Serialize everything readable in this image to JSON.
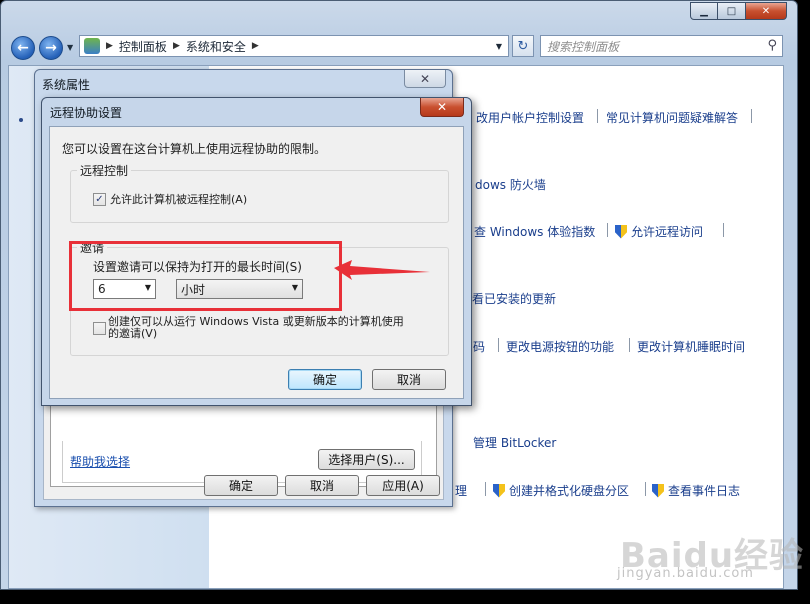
{
  "explorer": {
    "back_glyph": "←",
    "forward_glyph": "→",
    "breadcrumb": [
      "控制面板",
      "系统和安全"
    ],
    "search_placeholder": "搜索控制面板",
    "links": [
      "改用户帐户控制设置",
      "常见计算机问题疑难解答",
      "dows 防火墙",
      "查 Windows 体验指数",
      "允许远程访问",
      "看已安装的更新",
      "码",
      "更改电源按钮的功能",
      "更改计算机睡眠时间",
      "管理 BitLocker",
      "理",
      "创建并格式化硬盘分区",
      "查看事件日志"
    ]
  },
  "system_properties": {
    "title": "系统属性",
    "help_link": "帮助我选择",
    "select_users_button": "选择用户(S)...",
    "ok_button": "确定",
    "cancel_button": "取消",
    "apply_button": "应用(A)"
  },
  "remote_assistance": {
    "title": "远程协助设置",
    "description": "您可以设置在这台计算机上使用远程协助的限制。",
    "remote_control_group": "远程控制",
    "allow_remote_control": "允许此计算机被远程控制(A)",
    "allow_remote_control_checked": true,
    "invitation_group": "邀请",
    "invitation_time_label": "设置邀请可以保持为打开的最长时间(S)",
    "time_value": "6",
    "time_unit": "小时",
    "vista_only_line1": "创建仅可以从运行 Windows Vista 或更新版本的计算机使用",
    "vista_only_line2": "的邀请(V)",
    "vista_only_checked": false,
    "ok_button": "确定",
    "cancel_button": "取消"
  },
  "watermark": {
    "line1": "Baidu经验",
    "line2": "jingyan.baidu.com"
  },
  "colors": {
    "highlight": "#e83038",
    "link": "#1a3e8c"
  }
}
